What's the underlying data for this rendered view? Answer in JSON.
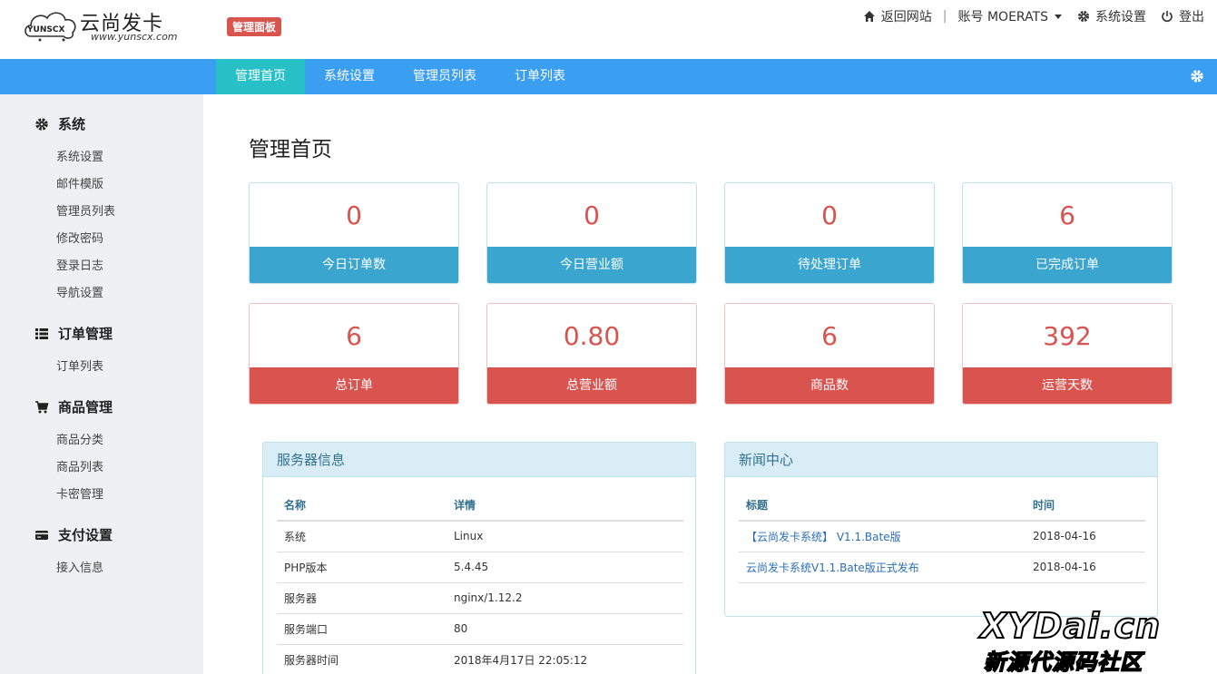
{
  "header": {
    "logo_badge": "YUNSCX",
    "logo_cn": "云尚发卡",
    "logo_url": "www.yunscx.com",
    "panel_badge": "管理面板",
    "back_site": "返回网站",
    "account": "账号 MOERATS",
    "settings": "系统设置",
    "logout": "登出"
  },
  "navbar": {
    "tabs": [
      {
        "label": "管理首页"
      },
      {
        "label": "系统设置"
      },
      {
        "label": "管理员列表"
      },
      {
        "label": "订单列表"
      }
    ]
  },
  "sidebar": {
    "groups": [
      {
        "title": "系统",
        "icon": "gear-icon",
        "items": [
          "系统设置",
          "邮件模版",
          "管理员列表",
          "修改密码",
          "登录日志",
          "导航设置"
        ]
      },
      {
        "title": "订单管理",
        "icon": "list-icon",
        "items": [
          "订单列表"
        ]
      },
      {
        "title": "商品管理",
        "icon": "cart-icon",
        "items": [
          "商品分类",
          "商品列表",
          "卡密管理"
        ]
      },
      {
        "title": "支付设置",
        "icon": "credit-card-icon",
        "items": [
          "接入信息"
        ]
      }
    ]
  },
  "main": {
    "title": "管理首页",
    "stats": [
      {
        "value": "0",
        "label": "今日订单数"
      },
      {
        "value": "0",
        "label": "今日营业额"
      },
      {
        "value": "0",
        "label": "待处理订单"
      },
      {
        "value": "6",
        "label": "已完成订单"
      },
      {
        "value": "6",
        "label": "总订单"
      },
      {
        "value": "0.80",
        "label": "总营业额"
      },
      {
        "value": "6",
        "label": "商品数"
      },
      {
        "value": "392",
        "label": "运营天数"
      }
    ],
    "server": {
      "title": "服务器信息",
      "headers": [
        "名称",
        "详情"
      ],
      "rows": [
        [
          "系统",
          "Linux"
        ],
        [
          "PHP版本",
          "5.4.45"
        ],
        [
          "服务器",
          "nginx/1.12.2"
        ],
        [
          "服务端口",
          "80"
        ],
        [
          "服务器时间",
          "2018年4月17日 22:05:12"
        ]
      ]
    },
    "news": {
      "title": "新闻中心",
      "headers": [
        "标题",
        "时间"
      ],
      "rows": [
        [
          "【云尚发卡系统】 V1.1.Bate版",
          "2018-04-16"
        ],
        [
          "云尚发卡系统V1.1.Bate版正式发布",
          "2018-04-16"
        ]
      ]
    }
  },
  "watermark": {
    "line1": "XYDai.cn",
    "line2": "新源代源码社区"
  },
  "colors": {
    "nav_blue": "#3a9ef1",
    "nav_active": "#27c0c6",
    "stat_blue": "#3aa6cf",
    "stat_red": "#d9534f"
  }
}
